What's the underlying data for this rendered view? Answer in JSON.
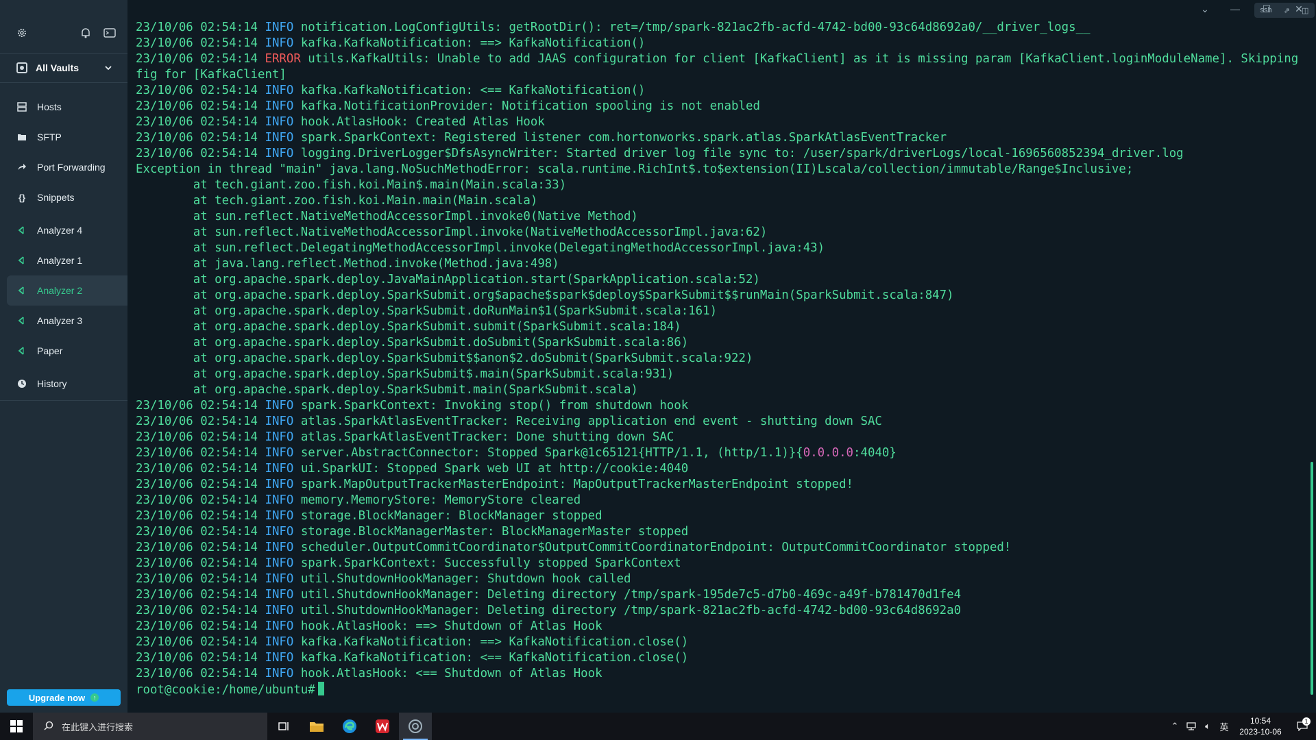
{
  "sidebar": {
    "vault_label": "All Vaults",
    "nav": [
      {
        "label": "Hosts",
        "icon": "hosts-icon"
      },
      {
        "label": "SFTP",
        "icon": "folder-icon"
      },
      {
        "label": "Port Forwarding",
        "icon": "port-forward-icon"
      },
      {
        "label": "Snippets",
        "icon": "braces-icon"
      },
      {
        "label": "Analyzer 4",
        "icon": "terminal-icon"
      },
      {
        "label": "Analyzer 1",
        "icon": "terminal-icon"
      },
      {
        "label": "Analyzer 2",
        "icon": "terminal-icon",
        "active": true
      },
      {
        "label": "Analyzer 3",
        "icon": "terminal-icon"
      },
      {
        "label": "Paper",
        "icon": "terminal-icon"
      },
      {
        "label": "History",
        "icon": "clock-icon"
      }
    ],
    "upgrade_label": "Upgrade now"
  },
  "terminal": {
    "prefix": "23/10/06 02:54:14",
    "lines": [
      {
        "lvl": "INFO",
        "msg": " notification.LogConfigUtils: getRootDir(): ret=/tmp/spark-821ac2fb-acfd-4742-bd00-93c64d8692a0/__driver_logs__"
      },
      {
        "lvl": "INFO",
        "msg": " kafka.KafkaNotification: ==> KafkaNotification()"
      },
      {
        "lvl": "ERROR",
        "msg": " utils.KafkaUtils: Unable to add JAAS configuration for client [KafkaClient] as it is missing param [KafkaClient.loginModuleName]. Skipping JAAS con"
      },
      {
        "raw": "fig for [KafkaClient]"
      },
      {
        "lvl": "INFO",
        "msg": " kafka.KafkaNotification: <== KafkaNotification()"
      },
      {
        "lvl": "INFO",
        "msg": " kafka.NotificationProvider: Notification spooling is not enabled"
      },
      {
        "lvl": "INFO",
        "msg": " hook.AtlasHook: Created Atlas Hook"
      },
      {
        "lvl": "INFO",
        "msg": " spark.SparkContext: Registered listener com.hortonworks.spark.atlas.SparkAtlasEventTracker"
      },
      {
        "lvl": "INFO",
        "msg": " logging.DriverLogger$DfsAsyncWriter: Started driver log file sync to: /user/spark/driverLogs/local-1696560852394_driver.log"
      },
      {
        "raw": "Exception in thread \"main\" java.lang.NoSuchMethodError: scala.runtime.RichInt$.to$extension(II)Lscala/collection/immutable/Range$Inclusive;"
      },
      {
        "raw": "        at tech.giant.zoo.fish.koi.Main$.main(Main.scala:33)"
      },
      {
        "raw": "        at tech.giant.zoo.fish.koi.Main.main(Main.scala)"
      },
      {
        "raw": "        at sun.reflect.NativeMethodAccessorImpl.invoke0(Native Method)"
      },
      {
        "raw": "        at sun.reflect.NativeMethodAccessorImpl.invoke(NativeMethodAccessorImpl.java:62)"
      },
      {
        "raw": "        at sun.reflect.DelegatingMethodAccessorImpl.invoke(DelegatingMethodAccessorImpl.java:43)"
      },
      {
        "raw": "        at java.lang.reflect.Method.invoke(Method.java:498)"
      },
      {
        "raw": "        at org.apache.spark.deploy.JavaMainApplication.start(SparkApplication.scala:52)"
      },
      {
        "raw": "        at org.apache.spark.deploy.SparkSubmit.org$apache$spark$deploy$SparkSubmit$$runMain(SparkSubmit.scala:847)"
      },
      {
        "raw": "        at org.apache.spark.deploy.SparkSubmit.doRunMain$1(SparkSubmit.scala:161)"
      },
      {
        "raw": "        at org.apache.spark.deploy.SparkSubmit.submit(SparkSubmit.scala:184)"
      },
      {
        "raw": "        at org.apache.spark.deploy.SparkSubmit.doSubmit(SparkSubmit.scala:86)"
      },
      {
        "raw": "        at org.apache.spark.deploy.SparkSubmit$$anon$2.doSubmit(SparkSubmit.scala:922)"
      },
      {
        "raw": "        at org.apache.spark.deploy.SparkSubmit$.main(SparkSubmit.scala:931)"
      },
      {
        "raw": "        at org.apache.spark.deploy.SparkSubmit.main(SparkSubmit.scala)"
      },
      {
        "lvl": "INFO",
        "msg": " spark.SparkContext: Invoking stop() from shutdown hook"
      },
      {
        "lvl": "INFO",
        "msg": " atlas.SparkAtlasEventTracker: Receiving application end event - shutting down SAC"
      },
      {
        "lvl": "INFO",
        "msg": " atlas.SparkAtlasEventTracker: Done shutting down SAC"
      },
      {
        "lvl": "INFO",
        "msg": " server.AbstractConnector: Stopped Spark@1c65121{HTTP/1.1, (http/1.1)}{",
        "mag": "0.0.0.0",
        "tail": ":4040}"
      },
      {
        "lvl": "INFO",
        "msg": " ui.SparkUI: Stopped Spark web UI at http://cookie:4040"
      },
      {
        "lvl": "INFO",
        "msg": " spark.MapOutputTrackerMasterEndpoint: MapOutputTrackerMasterEndpoint stopped!"
      },
      {
        "lvl": "INFO",
        "msg": " memory.MemoryStore: MemoryStore cleared"
      },
      {
        "lvl": "INFO",
        "msg": " storage.BlockManager: BlockManager stopped"
      },
      {
        "lvl": "INFO",
        "msg": " storage.BlockManagerMaster: BlockManagerMaster stopped"
      },
      {
        "lvl": "INFO",
        "msg": " scheduler.OutputCommitCoordinator$OutputCommitCoordinatorEndpoint: OutputCommitCoordinator stopped!"
      },
      {
        "lvl": "INFO",
        "msg": " spark.SparkContext: Successfully stopped SparkContext"
      },
      {
        "lvl": "INFO",
        "msg": " util.ShutdownHookManager: Shutdown hook called"
      },
      {
        "lvl": "INFO",
        "msg": " util.ShutdownHookManager: Deleting directory /tmp/spark-195de7c5-d7b0-469c-a49f-b781470d1fe4"
      },
      {
        "lvl": "INFO",
        "msg": " util.ShutdownHookManager: Deleting directory /tmp/spark-821ac2fb-acfd-4742-bd00-93c64d8692a0"
      },
      {
        "lvl": "INFO",
        "msg": " hook.AtlasHook: ==> Shutdown of Atlas Hook"
      },
      {
        "lvl": "INFO",
        "msg": " kafka.KafkaNotification: ==> KafkaNotification.close()"
      },
      {
        "lvl": "INFO",
        "msg": " kafka.KafkaNotification: <== KafkaNotification.close()"
      },
      {
        "lvl": "INFO",
        "msg": " hook.AtlasHook: <== Shutdown of Atlas Hook"
      }
    ],
    "prompt": "root@cookie:/home/ubuntu# "
  },
  "taskbar": {
    "search_placeholder": "在此键入进行搜索",
    "ime": "英",
    "time": "10:54",
    "date": "2023-10-06",
    "notif_count": "1"
  },
  "colors": {
    "accent": "#36c98e",
    "info": "#3fa6f2",
    "error": "#f05a5a",
    "upgrade": "#19a3ea"
  }
}
